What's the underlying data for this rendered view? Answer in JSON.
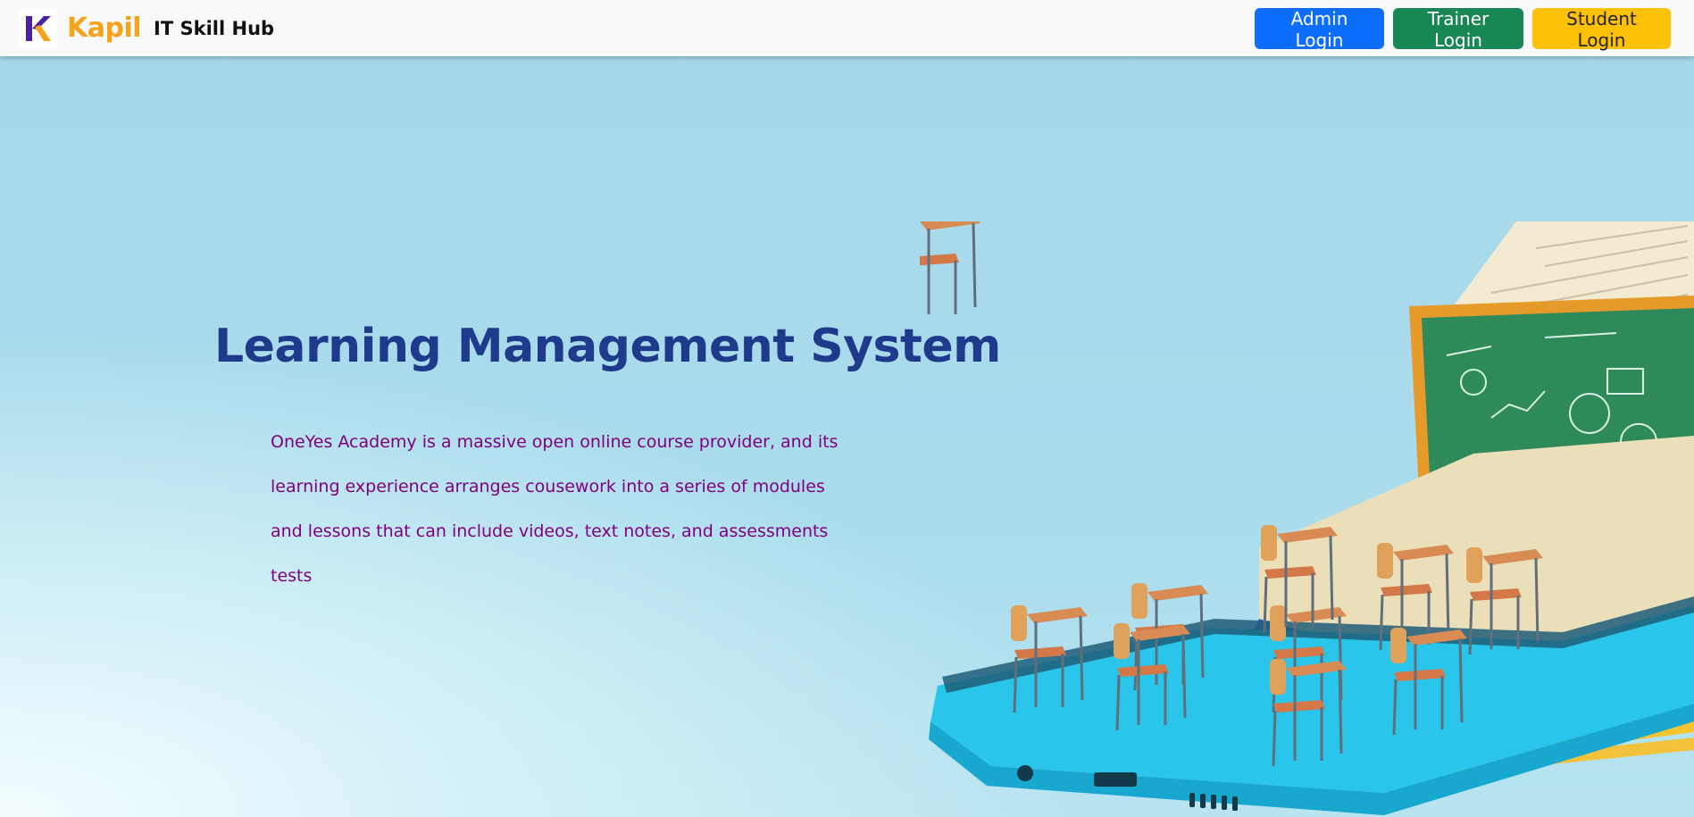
{
  "header": {
    "logo_icon": "k-logo-icon",
    "brand_name": "Kapil",
    "brand_subtitle": "IT Skill Hub",
    "buttons": {
      "admin_login": "Admin Login",
      "trainer_login": "Trainer Login",
      "student_login": "Student Login"
    }
  },
  "hero": {
    "title": "Learning Management System",
    "description": "OneYes Academy is a massive open online course provider, and its learning experience arranges cousework into a series of modules and lessons that can include videos, text notes, and assessments tests",
    "illustration": "classroom-on-smartphone-illustration"
  },
  "colors": {
    "admin_button": "#0d6efd",
    "trainer_button": "#198754",
    "student_button": "#ffc107",
    "brand": "#f6a21a",
    "title": "#1e3a8a",
    "description": "#800080",
    "background": "#a9dcec"
  }
}
